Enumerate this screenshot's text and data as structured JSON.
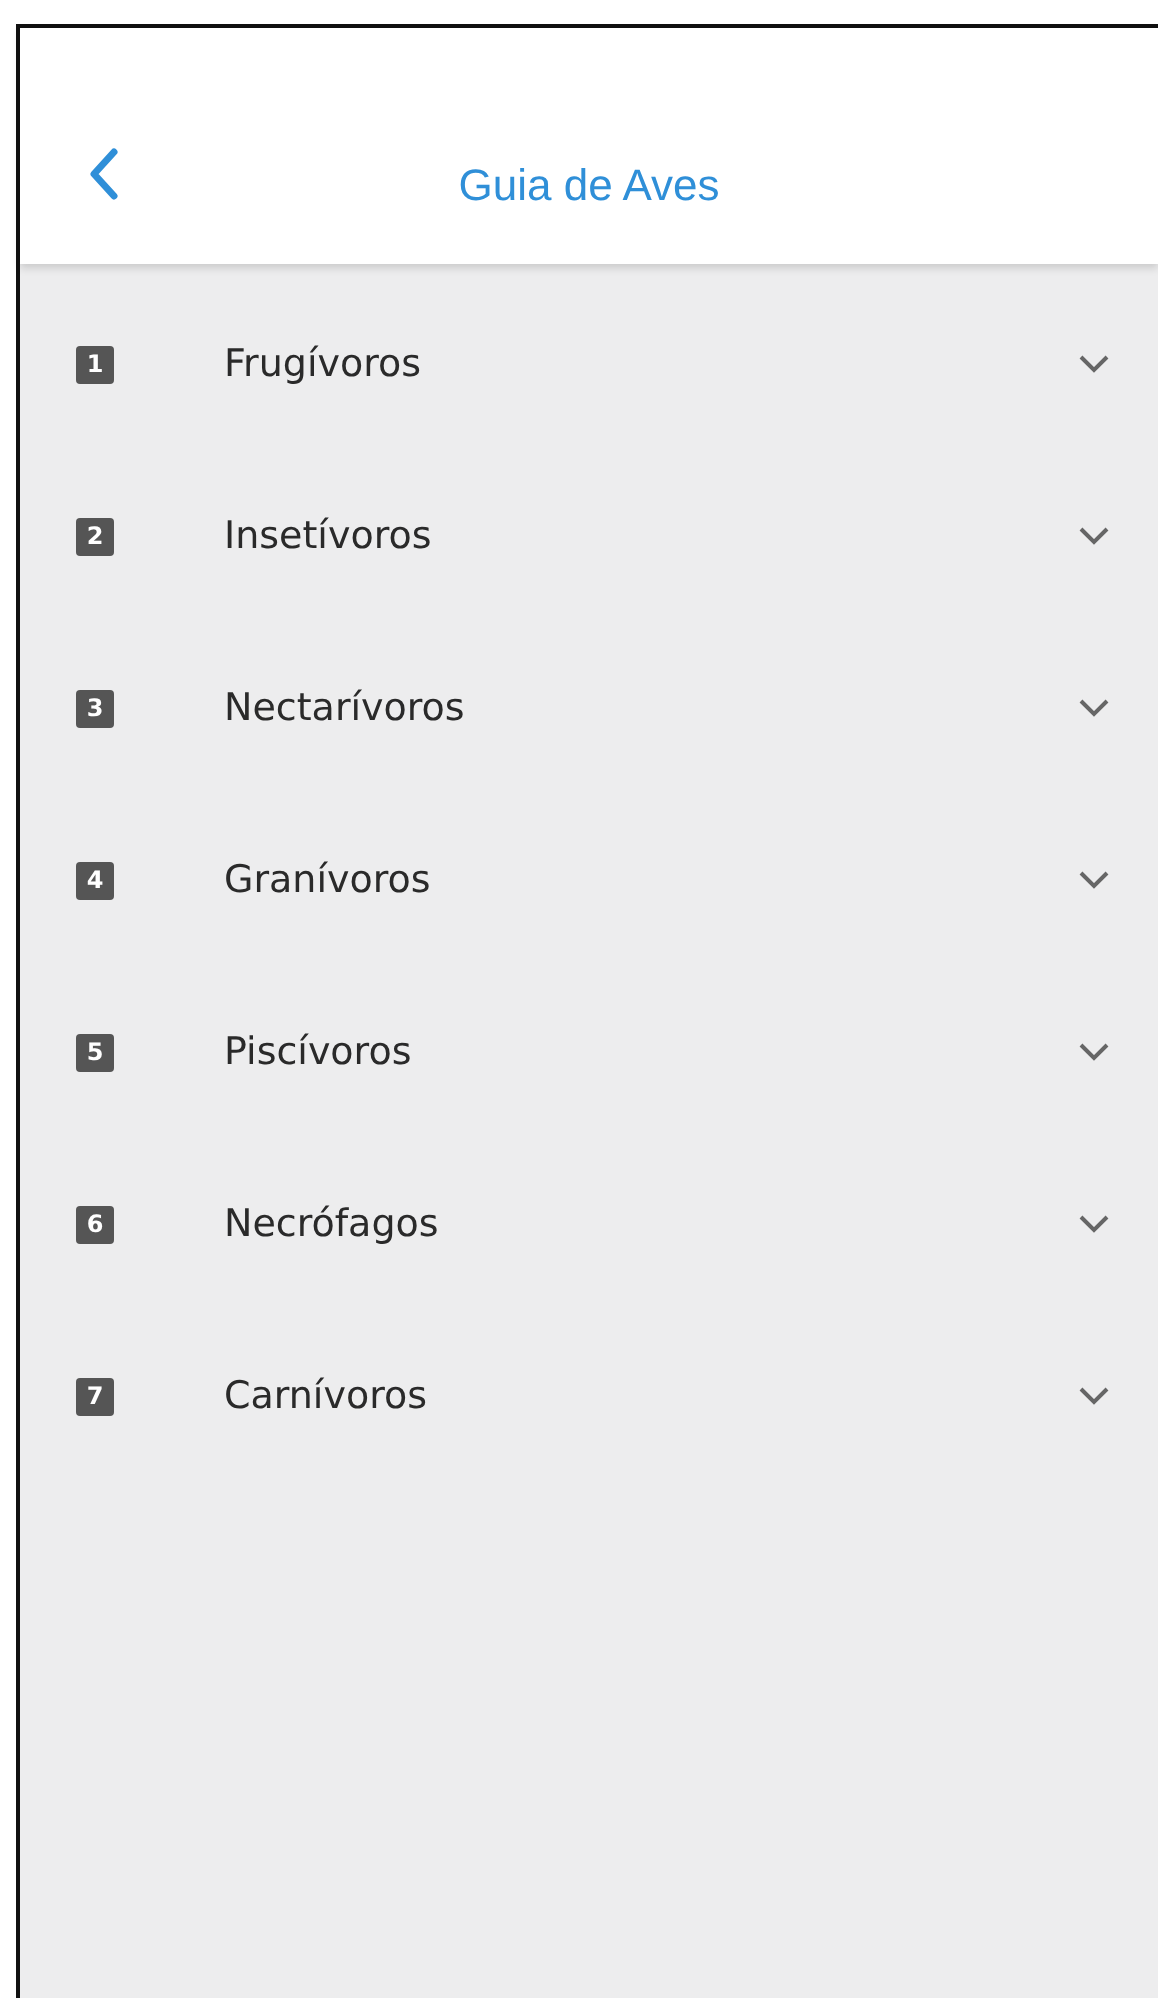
{
  "header": {
    "title": "Guia de Aves"
  },
  "categories": [
    {
      "number": "1",
      "label": "Frugívoros",
      "expanded": false
    },
    {
      "number": "2",
      "label": "Insetívoros",
      "expanded": false
    },
    {
      "number": "3",
      "label": "Nectarívoros",
      "expanded": false
    },
    {
      "number": "4",
      "label": "Granívoros",
      "expanded": false
    },
    {
      "number": "5",
      "label": "Piscívoros",
      "expanded": false
    },
    {
      "number": "6",
      "label": "Necrófagos",
      "expanded": false
    },
    {
      "number": "7",
      "label": "Carnívoros",
      "expanded": false
    }
  ]
}
